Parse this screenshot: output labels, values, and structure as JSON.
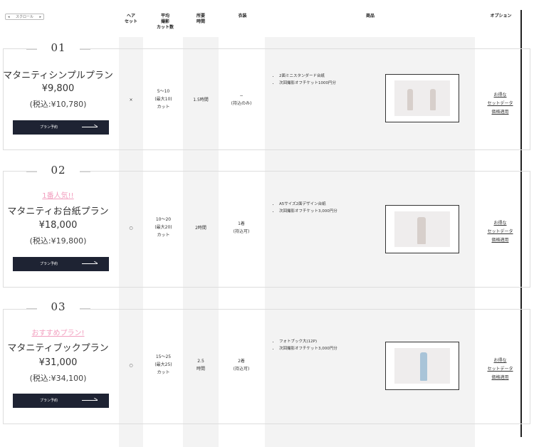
{
  "scroll_indicator": {
    "left_arrow": "◂",
    "label": "スクロール",
    "right_arrow": "▸"
  },
  "headers": {
    "hair_set": "ヘア\nセット",
    "avg_cuts": "平均\n撮影\nカット数",
    "duration": "所要\n時間",
    "costume": "衣装",
    "products": "商品",
    "options": "オプション"
  },
  "plans": [
    {
      "number": "01",
      "tag": "",
      "name": "マタニティシンプルプラン",
      "price": "¥9,800",
      "tax_price": "(税込:¥10,780)",
      "button_label": "プラン予約",
      "hair_set": "×",
      "cuts": "5〜10\n(最大10)\nカット",
      "duration": "1.5時間",
      "costume": "−\n(持込のみ)",
      "items": [
        "2面ミニスタンダード台紙",
        "次回撮影オフチケット1000円分"
      ],
      "options": [
        "お得な",
        "セットデータ",
        "価格適用"
      ]
    },
    {
      "number": "02",
      "tag": "1番人気!!",
      "name": "マタニティお台紙プラン",
      "price": "¥18,000",
      "tax_price": "(税込:¥19,800)",
      "button_label": "プラン予約",
      "hair_set": "○",
      "cuts": "10〜20\n(最大20)\nカット",
      "duration": "2時間",
      "costume": "1着\n(持込可)",
      "items": [
        "A5サイズ2面デザイン台紙",
        "次回撮影オフチケット3,000円分"
      ],
      "options": [
        "お得な",
        "セットデータ",
        "価格適用"
      ]
    },
    {
      "number": "03",
      "tag": "おすすめプラン!",
      "name": "マタニティブックプラン",
      "price": "¥31,000",
      "tax_price": "(税込:¥34,100)",
      "button_label": "プラン予約",
      "hair_set": "○",
      "cuts": "15〜25\n(最大25)\nカット",
      "duration": "2.5\n時間",
      "costume": "2着\n(持込可)",
      "items": [
        "フォトブック大(12P)",
        "次回撮影オフチケット3,000円分"
      ],
      "options": [
        "お得な",
        "セットデータ",
        "価格適用"
      ]
    }
  ],
  "colors": {
    "accent_pink": "#f29fbf",
    "button_bg": "#1e2333",
    "column_bg": "#f3f3f3"
  }
}
